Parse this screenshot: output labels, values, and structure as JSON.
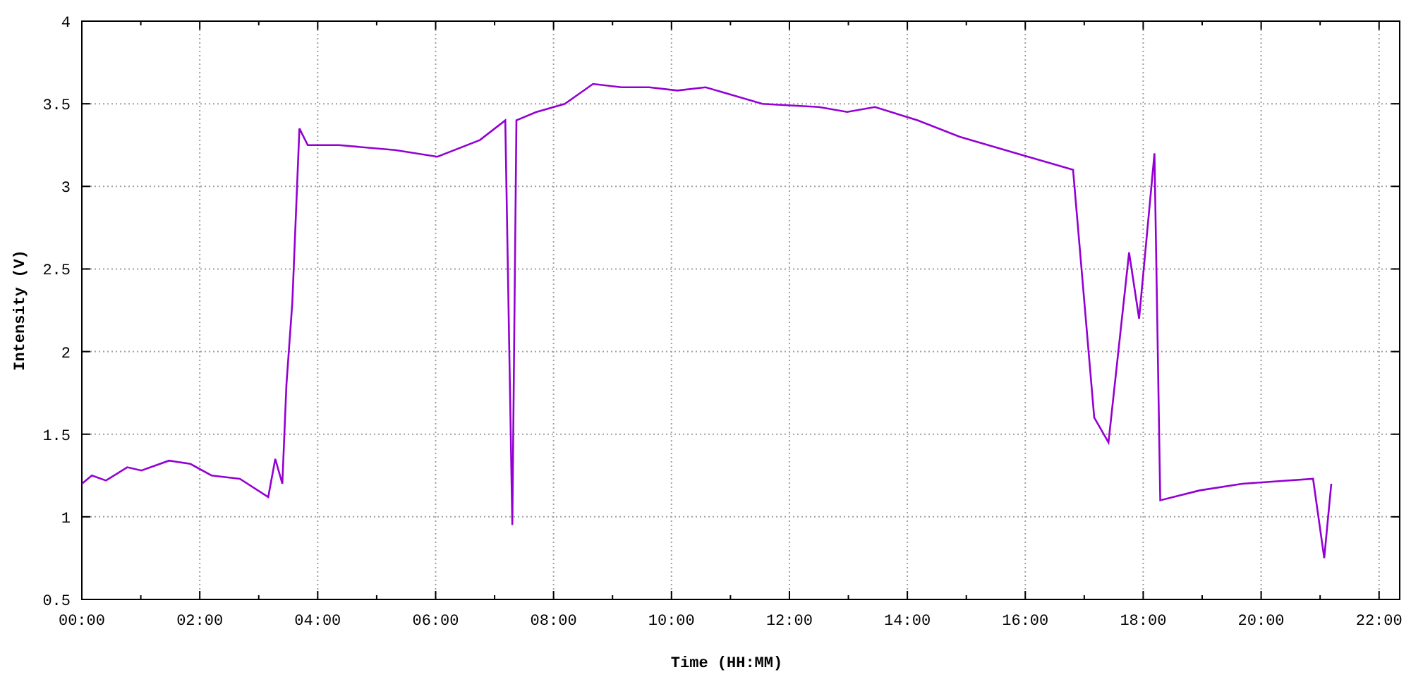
{
  "chart": {
    "chart_data": {
      "type": "line",
      "xlabel": "Time (HH:MM)",
      "ylabel": "Intensity (V)",
      "x": [
        0,
        0.17,
        0.41,
        0.77,
        1.01,
        1.48,
        1.84,
        2.2,
        2.68,
        3.16,
        3.28,
        3.4,
        3.47,
        3.57,
        3.69,
        3.83,
        4.36,
        5.31,
        6.03,
        6.75,
        7.18,
        7.3,
        7.37,
        7.71,
        8.19,
        8.67,
        9.15,
        9.62,
        10.1,
        10.58,
        11.54,
        12.5,
        12.98,
        13.45,
        14.17,
        14.89,
        15.85,
        16.81,
        17.17,
        17.41,
        17.76,
        17.93,
        18.19,
        18.29,
        18.96,
        19.68,
        20.88,
        21.07,
        21.19
      ],
      "series": [
        {
          "color": "#9400d3",
          "values": [
            1.2,
            1.25,
            1.22,
            1.3,
            1.28,
            1.34,
            1.32,
            1.25,
            1.23,
            1.12,
            1.35,
            1.2,
            1.8,
            2.3,
            3.35,
            3.25,
            3.25,
            3.22,
            3.18,
            3.28,
            3.4,
            0.95,
            3.4,
            3.45,
            3.5,
            3.62,
            3.6,
            3.6,
            3.58,
            3.6,
            3.5,
            3.48,
            3.45,
            3.48,
            3.4,
            3.3,
            3.2,
            3.1,
            1.6,
            1.45,
            2.6,
            2.2,
            3.2,
            1.1,
            1.16,
            1.2,
            1.23,
            0.75,
            1.2
          ]
        }
      ],
      "xlim": [
        0,
        22.35
      ],
      "ylim": [
        0.5,
        4
      ],
      "xticks": [
        {
          "value": 0,
          "label": "00:00"
        },
        {
          "value": 2,
          "label": "02:00"
        },
        {
          "value": 4,
          "label": "04:00"
        },
        {
          "value": 6,
          "label": "06:00"
        },
        {
          "value": 8,
          "label": "08:00"
        },
        {
          "value": 10,
          "label": "10:00"
        },
        {
          "value": 12,
          "label": "12:00"
        },
        {
          "value": 14,
          "label": "14:00"
        },
        {
          "value": 16,
          "label": "16:00"
        },
        {
          "value": 18,
          "label": "18:00"
        },
        {
          "value": 20,
          "label": "20:00"
        },
        {
          "value": 22,
          "label": "22:00"
        }
      ],
      "yticks": [
        0.5,
        1,
        1.5,
        2,
        2.5,
        3,
        3.5,
        4
      ],
      "grid": true
    }
  }
}
